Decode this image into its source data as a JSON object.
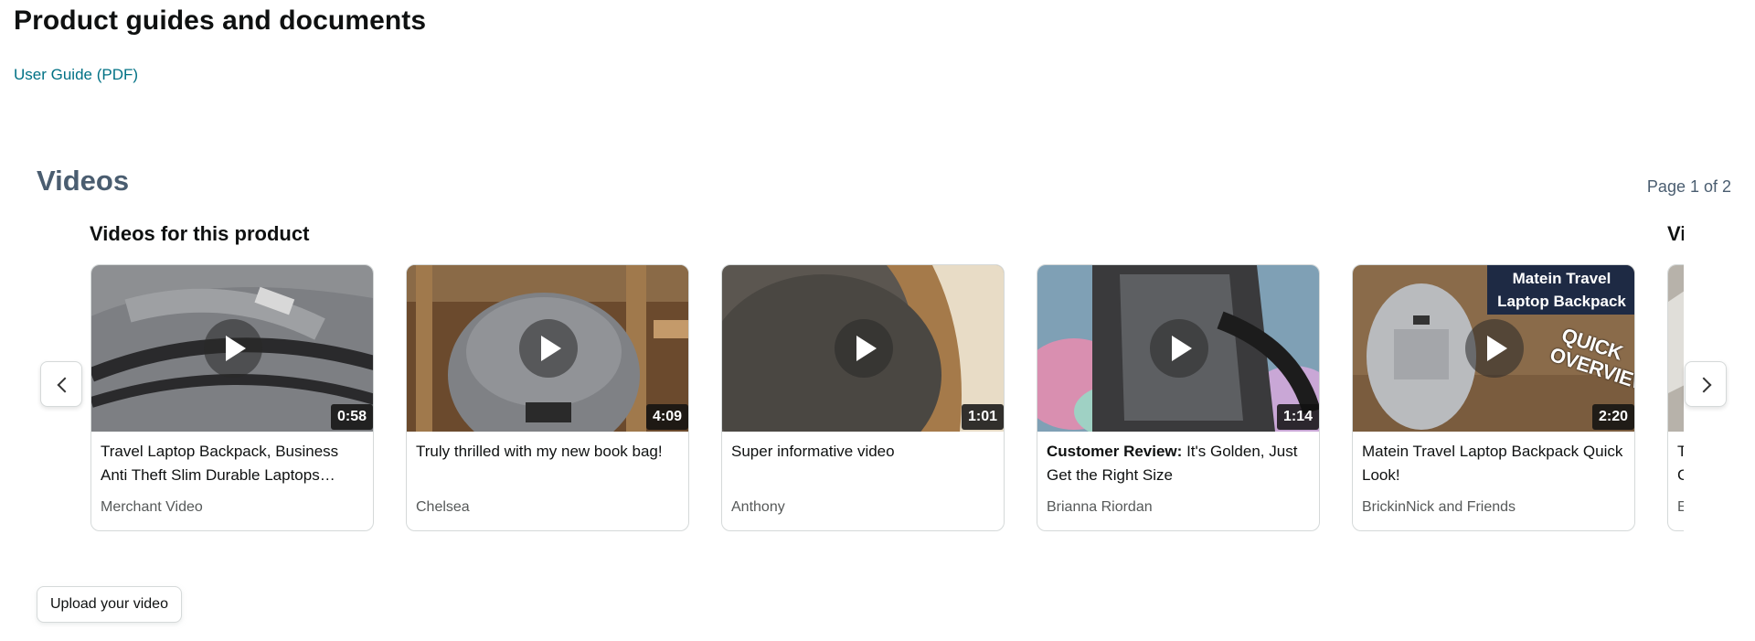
{
  "guides": {
    "title": "Product guides and documents",
    "link": "User Guide (PDF)"
  },
  "videos": {
    "title": "Videos",
    "page_indicator": "Page 1 of 2",
    "row_title": "Videos for this product",
    "next_row_title_peek": "Vi",
    "cards": [
      {
        "title": "Travel Laptop Backpack, Business Anti Theft Slim Durable Laptops…",
        "author": "Merchant Video",
        "duration": "0:58"
      },
      {
        "title": "Truly thrilled with my new book bag!",
        "author": "Chelsea",
        "duration": "4:09"
      },
      {
        "title": "Super informative video",
        "author": "Anthony",
        "duration": "1:01"
      },
      {
        "title_prefix": "Customer Review:",
        "title": "It's Golden, Just Get the Right Size",
        "author": "Brianna Riordan",
        "duration": "1:14"
      },
      {
        "title": "Matein Travel Laptop Backpack Quick Look!",
        "author": "BrickinNick and Friends",
        "duration": "2:20",
        "thumb_overlay": {
          "banner": "Matein Travel Laptop Backpack",
          "stamp": "QUICK OVERVIEW"
        }
      },
      {
        "title": "T C",
        "author": "E"
      }
    ],
    "upload_button": "Upload your video"
  },
  "colors": {
    "link": "#007185",
    "section_heading": "#4a5d70",
    "card_border": "#d5d9d9",
    "muted_text": "#565959"
  },
  "icons": {
    "prev": "chevron-left-icon",
    "next": "chevron-right-icon",
    "play": "play-icon"
  }
}
